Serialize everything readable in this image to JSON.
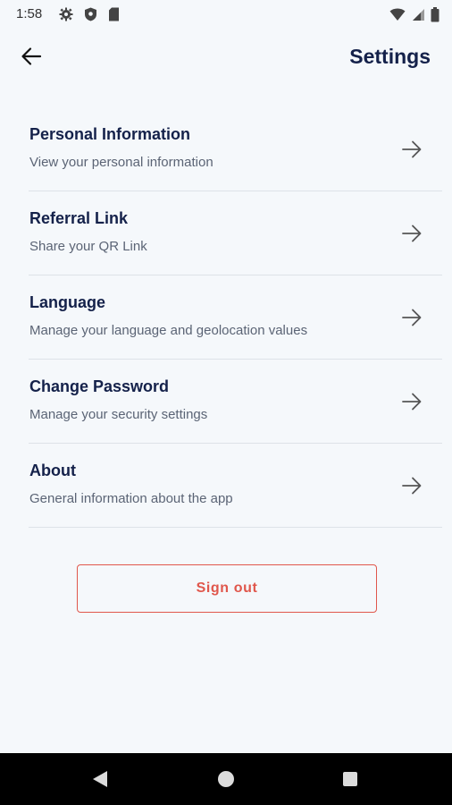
{
  "status_bar": {
    "time": "1:58",
    "icons_left": [
      "gear-icon",
      "shield-icon",
      "sd-card-icon"
    ],
    "icons_right": [
      "wifi-icon",
      "signal-icon",
      "battery-icon"
    ]
  },
  "header": {
    "title": "Settings",
    "back_icon": "arrow-left-icon"
  },
  "settings": {
    "items": [
      {
        "title": "Personal Information",
        "subtitle": "View your personal information"
      },
      {
        "title": "Referral Link",
        "subtitle": "Share your QR Link"
      },
      {
        "title": "Language",
        "subtitle": "Manage your language and geolocation values"
      },
      {
        "title": "Change Password",
        "subtitle": "Manage your security settings"
      },
      {
        "title": "About",
        "subtitle": "General information about the app"
      }
    ]
  },
  "signout": {
    "label": "Sign out",
    "color": "#e0574c"
  },
  "nav_bar": {
    "icons": [
      "back-triangle-icon",
      "home-circle-icon",
      "recents-square-icon"
    ]
  },
  "colors": {
    "background": "#f5f8fb",
    "title_text": "#14214a",
    "subtitle_text": "#5b6475",
    "divider": "#dde2e8"
  }
}
